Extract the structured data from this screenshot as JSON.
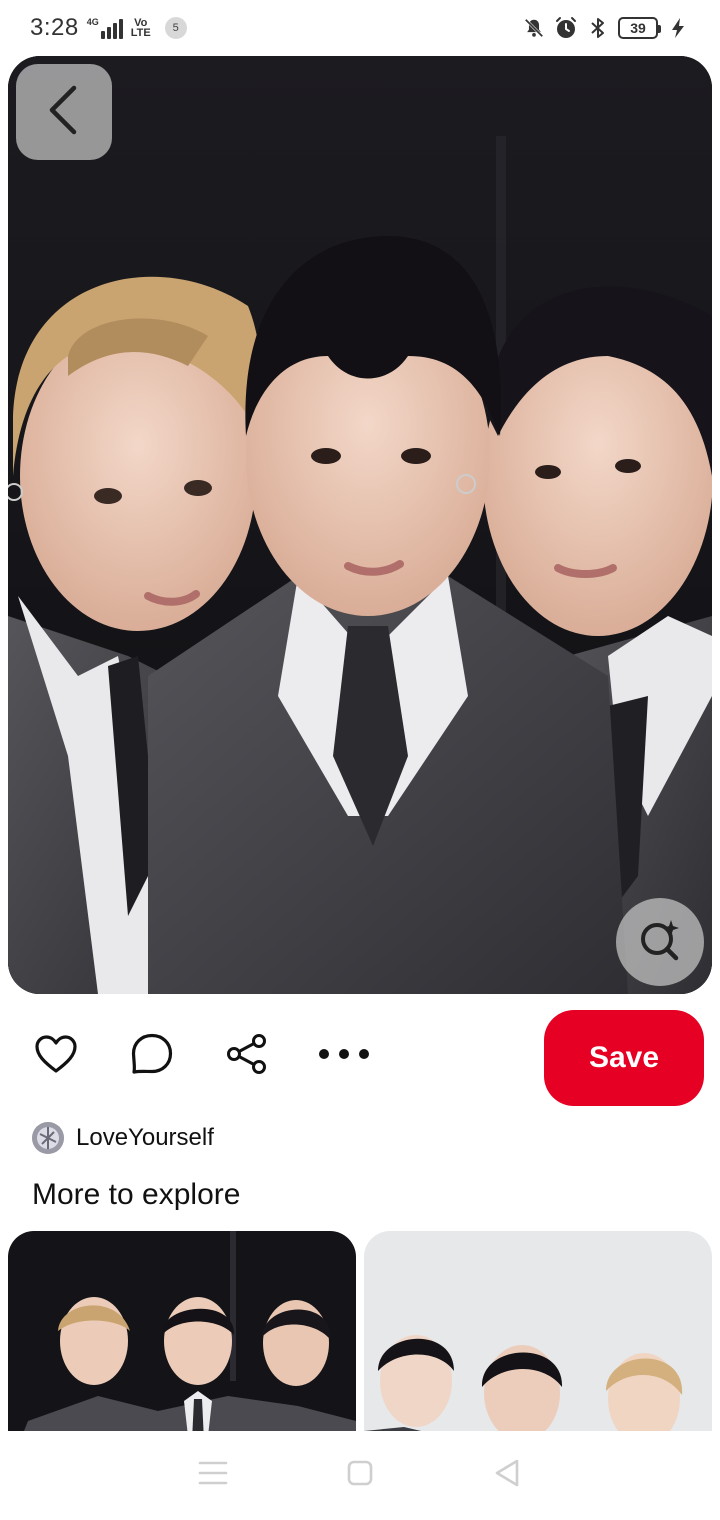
{
  "status_bar": {
    "time": "3:28",
    "network_type": "4G",
    "volte_top": "Vo",
    "volte_bottom": "LTE",
    "notification_count": "5",
    "battery": "39"
  },
  "pin": {
    "actions": {
      "save_label": "Save"
    },
    "creator": {
      "name": "LoveYourself"
    }
  },
  "explore": {
    "title": "More to explore"
  },
  "colors": {
    "save_button": "#e60023",
    "overlay_button": "#c8c8c8"
  },
  "icons": {
    "back": "chevron-left-icon",
    "visual_search": "lens-search-icon",
    "like": "heart-icon",
    "comment": "comment-icon",
    "share": "share-icon",
    "more": "more-icon"
  }
}
